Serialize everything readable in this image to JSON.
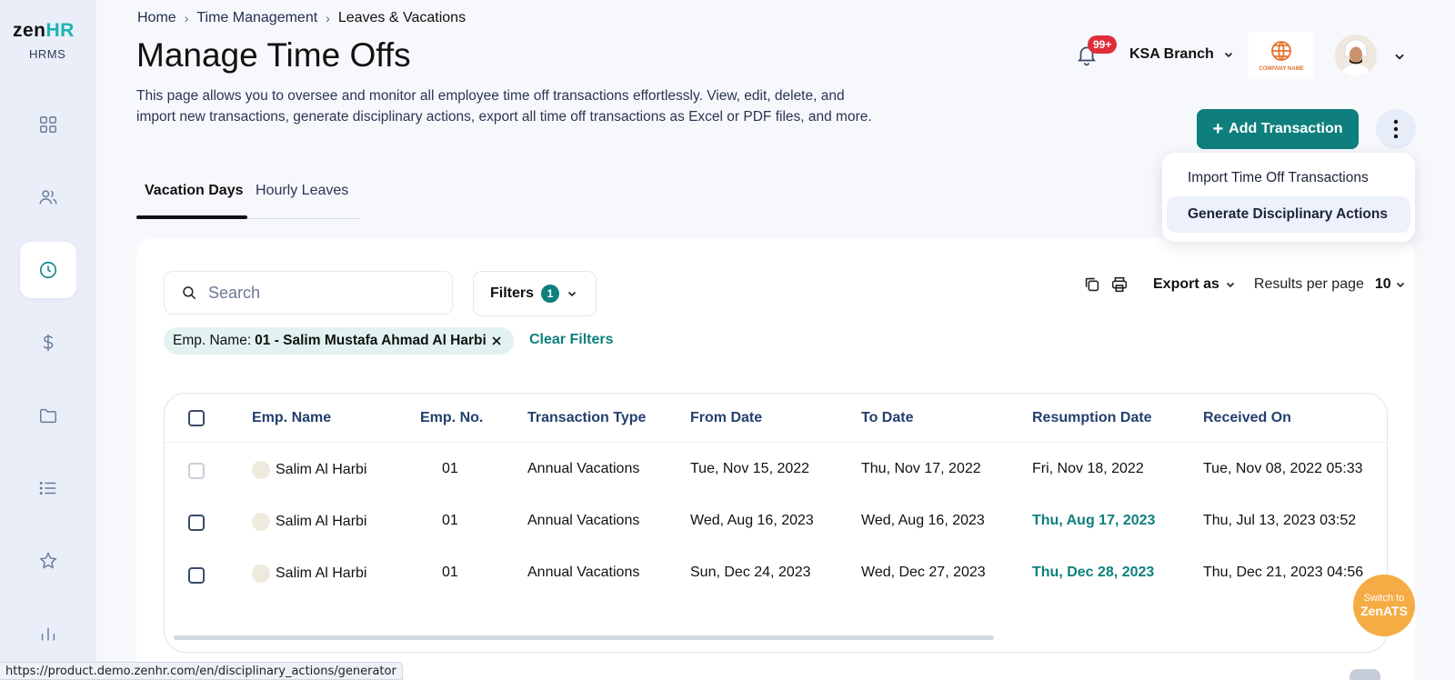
{
  "brand": {
    "logo_main": "zen",
    "logo_accent": "HR",
    "product": "HRMS"
  },
  "sidebar": {
    "items": [
      {
        "name": "dashboard",
        "icon": "grid-icon",
        "active": false
      },
      {
        "name": "employees",
        "icon": "users-icon",
        "active": false
      },
      {
        "name": "time-management",
        "icon": "clock-icon",
        "active": true
      },
      {
        "name": "payroll",
        "icon": "dollar-icon",
        "active": false
      },
      {
        "name": "documents",
        "icon": "folder-icon",
        "active": false
      },
      {
        "name": "lists",
        "icon": "list-icon",
        "active": false
      },
      {
        "name": "performance",
        "icon": "star-icon",
        "active": false
      },
      {
        "name": "reports",
        "icon": "bar-chart-icon",
        "active": false
      }
    ]
  },
  "breadcrumb": {
    "home": "Home",
    "section": "Time Management",
    "current": "Leaves & Vacations"
  },
  "page": {
    "title": "Manage Time Offs",
    "description": "This page allows you to oversee and monitor all employee time off transactions effortlessly. View, edit, delete, and import new transactions, generate disciplinary actions, export all time off transactions as Excel or PDF files, and more."
  },
  "topbar": {
    "notifications_badge": "99+",
    "branch": "KSA Branch",
    "company_logo_text": "COMPANY NAME"
  },
  "actions": {
    "add_transaction": "Add Transaction",
    "menu": [
      "Import Time Off Transactions",
      "Generate Disciplinary Actions"
    ]
  },
  "tabs": [
    "Vacation Days",
    "Hourly Leaves"
  ],
  "toolbar": {
    "search_placeholder": "Search",
    "filters_label": "Filters",
    "filters_count": "1",
    "export_label": "Export as",
    "results_per_page_label": "Results per page",
    "results_per_page_value": "10"
  },
  "active_filter": {
    "key": "Emp. Name:",
    "value": "01 - Salim Mustafa Ahmad Al Harbi",
    "clear": "Clear Filters"
  },
  "table": {
    "columns": [
      "Emp. Name",
      "Emp. No.",
      "Transaction Type",
      "From Date",
      "To Date",
      "Resumption Date",
      "Received On"
    ],
    "rows": [
      {
        "name": "Salim Al Harbi",
        "no": "01",
        "type": "Annual Vacations",
        "from": "Tue, Nov 15, 2022",
        "to": "Thu, Nov 17, 2022",
        "resumption": "Fri, Nov 18, 2022",
        "received": "Tue, Nov 08, 2022 05:33"
      },
      {
        "name": "Salim Al Harbi",
        "no": "01",
        "type": "Annual Vacations",
        "from": "Wed, Aug 16, 2023",
        "to": "Wed, Aug 16, 2023",
        "resumption": "Thu, Aug 17, 2023",
        "received": "Thu, Jul 13, 2023 03:52"
      },
      {
        "name": "Salim Al Harbi",
        "no": "01",
        "type": "Annual Vacations",
        "from": "Sun, Dec 24, 2023",
        "to": "Wed, Dec 27, 2023",
        "resumption": "Thu, Dec 28, 2023",
        "received": "Thu, Dec 21, 2023 04:56"
      }
    ]
  },
  "status_url": "https://product.demo.zenhr.com/en/disciplinary_actions/generator",
  "switch_ats": {
    "line1": "Switch to",
    "line2": "ZenATS"
  },
  "colors": {
    "primary": "#0e7f7d",
    "sidebar_bg": "#e9eef9",
    "badge": "#e02d3c",
    "ats": "#f6ac45"
  }
}
